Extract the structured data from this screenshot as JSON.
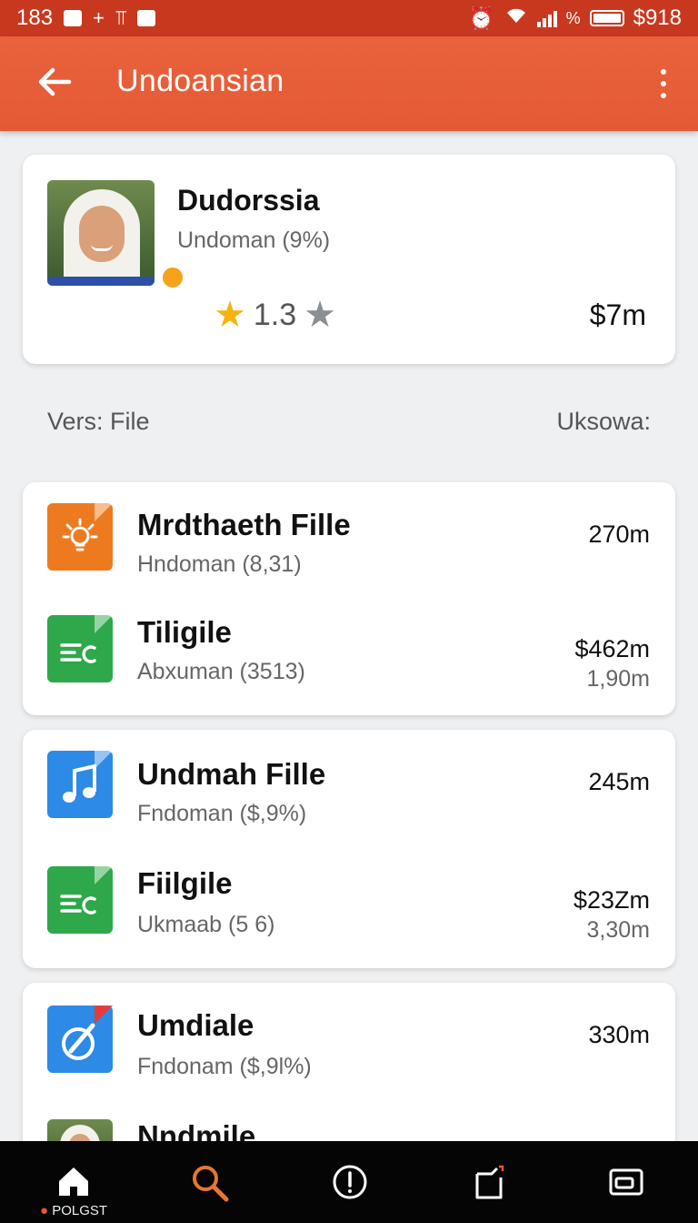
{
  "status_bar": {
    "time": "183",
    "right_text": "$918"
  },
  "app_bar": {
    "title": "Undoansian"
  },
  "profile": {
    "name": "Dudorssia",
    "subtitle": "Undoman (9%)",
    "rating": "1.3",
    "rating_stars_filled": 1,
    "rating_stars_total": 2,
    "price": "$7m"
  },
  "section": {
    "left": "Vers: File",
    "right": "Uksowa:"
  },
  "files": [
    {
      "icon": "lightbulb-icon",
      "color": "#ee7a1f",
      "name": "Mrdthaeth Fille",
      "sub": "Hndoman (8,31)",
      "size": "270m",
      "size2": ""
    },
    {
      "icon": "document-icon",
      "color": "#2ea84a",
      "name": "Tiligile",
      "sub": "Abxuman (3513)",
      "size": "$462m",
      "size2": "1,90m"
    },
    {
      "icon": "music-note-icon",
      "color": "#2d8ae6",
      "name": "Undmah Fille",
      "sub": "Fndoman ($,9%)",
      "size": "245m",
      "size2": ""
    },
    {
      "icon": "document-icon",
      "color": "#2ea84a",
      "name": "Fiilgile",
      "sub": "Ukmaab (5 6)",
      "size": "$23Zm",
      "size2": "3,30m"
    },
    {
      "icon": "edit-icon",
      "color": "#2d8ae6",
      "name": "Umdiale",
      "sub": "Fndonam ($,9l%)",
      "size": "330m",
      "size2": ""
    },
    {
      "icon": "avatar",
      "color": "",
      "name": "Nndmile",
      "sub": "",
      "size": "",
      "size2": ""
    }
  ],
  "bottom_nav": {
    "items": [
      "home-icon",
      "search-icon",
      "info-icon",
      "share-icon",
      "window-icon"
    ],
    "label": "POLGST"
  }
}
